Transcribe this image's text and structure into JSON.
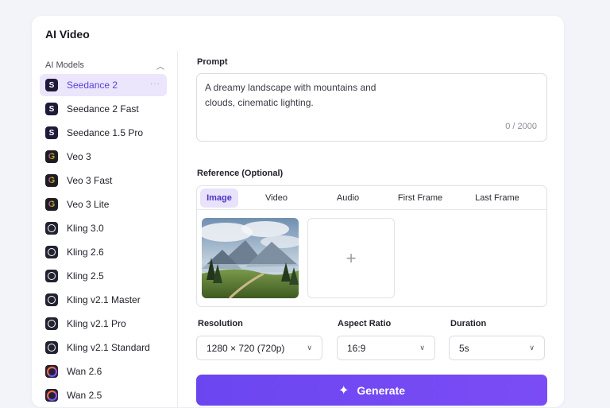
{
  "app": {
    "title": "AI Video"
  },
  "sidebar": {
    "section_label": "AI Models",
    "models": [
      {
        "label": "Seedance 2",
        "icon": "seedance-icon",
        "active": true
      },
      {
        "label": "Seedance 2 Fast",
        "icon": "seedance-icon"
      },
      {
        "label": "Seedance 1.5 Pro",
        "icon": "seedance-icon"
      },
      {
        "label": "Veo 3",
        "icon": "google-icon"
      },
      {
        "label": "Veo 3 Fast",
        "icon": "google-icon"
      },
      {
        "label": "Veo 3 Lite",
        "icon": "google-icon"
      },
      {
        "label": "Kling 3.0",
        "icon": "kling-icon"
      },
      {
        "label": "Kling 2.6",
        "icon": "kling-icon"
      },
      {
        "label": "Kling 2.5",
        "icon": "kling-icon"
      },
      {
        "label": "Kling v2.1 Master",
        "icon": "kling-icon"
      },
      {
        "label": "Kling v2.1 Pro",
        "icon": "kling-icon"
      },
      {
        "label": "Kling v2.1 Standard",
        "icon": "kling-icon"
      },
      {
        "label": "Wan 2.6",
        "icon": "wan-icon"
      },
      {
        "label": "Wan 2.5",
        "icon": "wan-icon"
      }
    ]
  },
  "prompt": {
    "label": "Prompt",
    "text": "A dreamy landscape with mountains and clouds, cinematic lighting.",
    "count": "0 / 2000"
  },
  "reference": {
    "label": "Reference (Optional)",
    "tabs": [
      "Image",
      "Video",
      "Audio",
      "First Frame",
      "Last Frame"
    ],
    "active_tab": "Image"
  },
  "options": {
    "resolution": {
      "label": "Resolution",
      "value": "1280 × 720 (720p)"
    },
    "aspect_ratio": {
      "label": "Aspect Ratio",
      "value": "16:9"
    },
    "duration": {
      "label": "Duration",
      "value": "5s"
    }
  },
  "generate": {
    "label": "Generate"
  },
  "colors": {
    "accent": "#6b46f0",
    "active_bg": "#ebe6fb"
  }
}
